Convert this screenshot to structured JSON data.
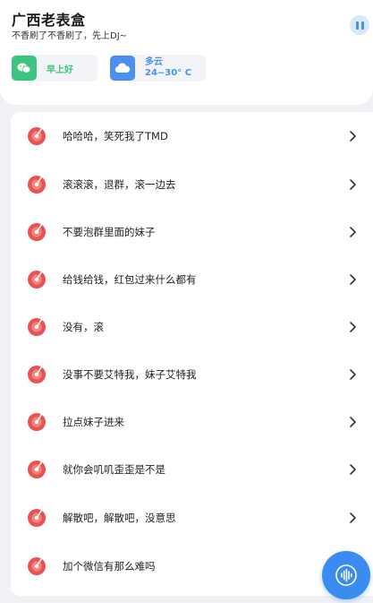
{
  "header": {
    "title": "广西老表盒",
    "subtitle": "不香刷了不香刷了，先上DJ~"
  },
  "greeting_card": {
    "label": "早上好",
    "icon": "wechat-icon"
  },
  "weather_card": {
    "condition": "多云",
    "temperature": "24~30° C",
    "icon": "cloud-icon"
  },
  "colors": {
    "accent_green": "#3cc481",
    "accent_blue": "#4b8ff0",
    "item_icon_red": "#e8534f"
  },
  "sound_list": {
    "items": [
      {
        "label": "哈哈哈，笑死我了TMD"
      },
      {
        "label": "滚滚滚，退群，滚一边去"
      },
      {
        "label": "不要泡群里面的妹子"
      },
      {
        "label": "给钱给钱，红包过来什么都有"
      },
      {
        "label": "没有，滚"
      },
      {
        "label": "没事不要艾特我，妹子艾特我"
      },
      {
        "label": "拉点妹子进来"
      },
      {
        "label": "就你会叽叽歪歪是不是"
      },
      {
        "label": "解散吧，解散吧，没意思"
      },
      {
        "label": "加个微信有那么难吗"
      }
    ]
  }
}
